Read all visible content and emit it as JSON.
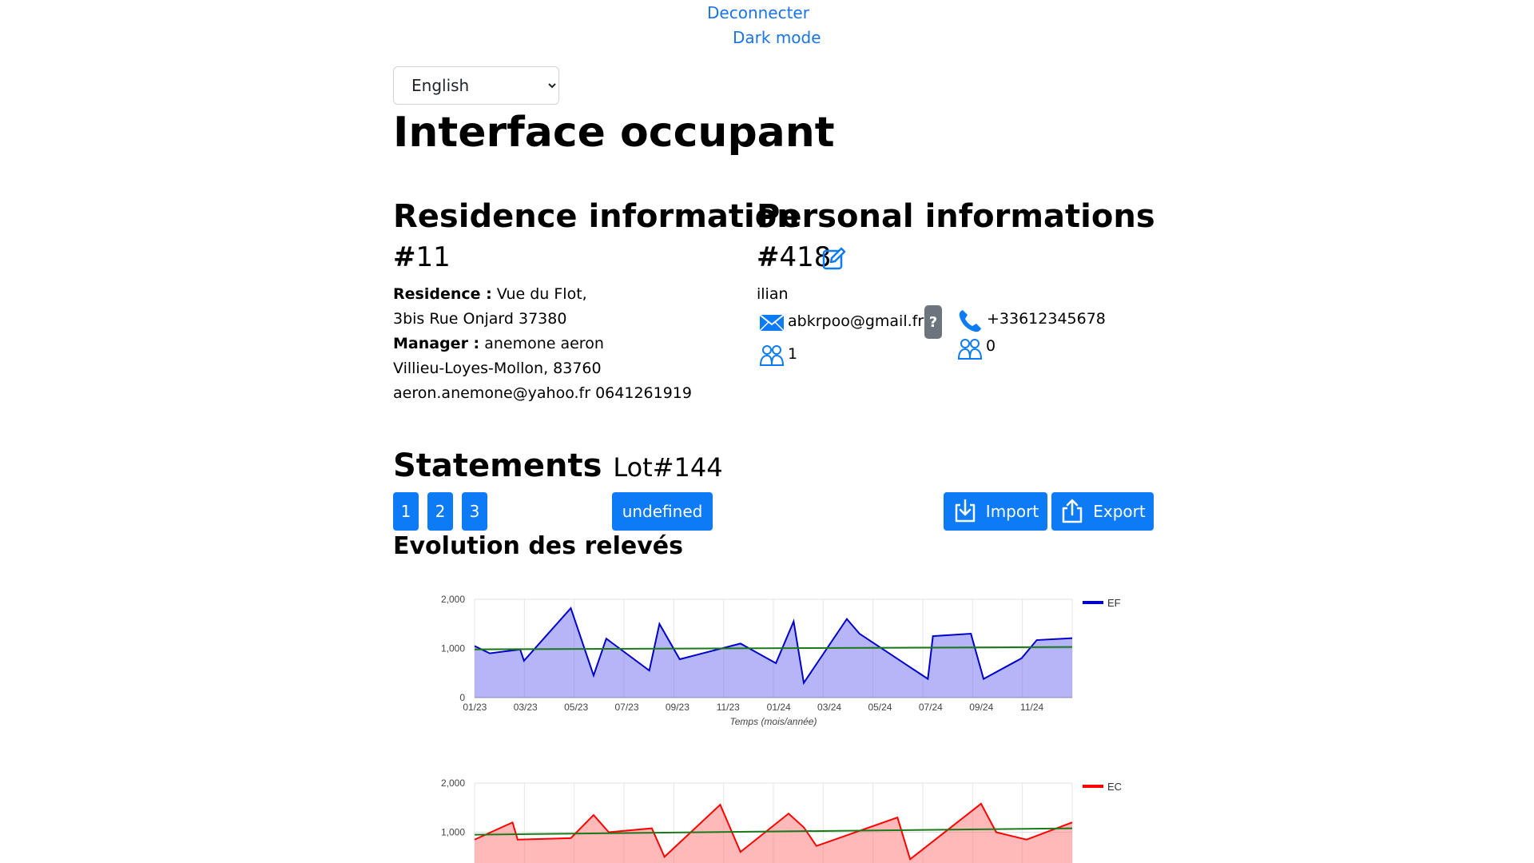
{
  "top_links": {
    "logout": "Deconnecter",
    "dark_mode": "Dark mode"
  },
  "language": {
    "selected": "English"
  },
  "page_title": "Interface occupant",
  "residence": {
    "heading": "Residence information",
    "hash": "#",
    "id": "11",
    "residence_label": "Residence :",
    "residence_name": " Vue du Flot,",
    "address": "3bis Rue Onjard 37380",
    "manager_label": "Manager :",
    "manager_name": " anemone aeron",
    "manager_city": "Villieu-Loyes-Mollon, 83760",
    "manager_contact": "aeron.anemone@yahoo.fr 0641261919"
  },
  "personal": {
    "heading": "Personal informations",
    "hash": "#",
    "id": "418",
    "name": "ilian",
    "email": "abkrpoo@gmail.fr",
    "help": "?",
    "phone": "+33612345678",
    "adults": "1",
    "children": "0"
  },
  "statements": {
    "heading": "Statements",
    "lot": "Lot#144",
    "page_buttons": [
      "1",
      "2",
      "3"
    ],
    "undefined_button": "undefined",
    "import_label": "Import",
    "export_label": "Export",
    "evolution_title": "Evolution des relevés"
  },
  "colors": {
    "accent": "#0d7bf5",
    "ef": "#0000cc",
    "ec": "#ff0000",
    "trend": "#1a7a1a"
  },
  "chart_data": [
    {
      "type": "area",
      "legend": "EF",
      "xlabel": "Temps (mois/année)",
      "ylim": [
        0,
        2000
      ],
      "yticks": [
        "2,000",
        "1,000",
        "0"
      ],
      "xticks": [
        "01/23",
        "03/23",
        "05/23",
        "07/23",
        "09/23",
        "11/23",
        "01/24",
        "03/24",
        "05/24",
        "07/24",
        "09/24",
        "11/24"
      ],
      "x": [
        0,
        0.6,
        1.8,
        1.95,
        3.8,
        4.7,
        5.2,
        6.9,
        7.3,
        8.1,
        10.5,
        11.9,
        12.6,
        13.0,
        14.7,
        15.2,
        17.9,
        18.1,
        19.6,
        20.1,
        21.6,
        22.2,
        23.6
      ],
      "y": [
        1050,
        900,
        980,
        750,
        1820,
        450,
        1200,
        550,
        1500,
        780,
        1100,
        700,
        1550,
        300,
        1600,
        1300,
        380,
        1250,
        1300,
        380,
        800,
        1170,
        1210
      ],
      "trend": [
        980,
        1030
      ],
      "legend_position": "top-right",
      "grid": true
    },
    {
      "type": "area",
      "legend": "EC",
      "ylim": [
        0,
        2000
      ],
      "yticks": [
        "2,000",
        "1,000"
      ],
      "x": [
        0,
        1.5,
        1.7,
        3.8,
        4.7,
        5.3,
        7.0,
        7.5,
        9.7,
        10.5,
        12.4,
        13.0,
        13.5,
        16.7,
        17.2,
        20.0,
        20.6,
        21.8,
        23.6
      ],
      "y": [
        850,
        1200,
        850,
        880,
        1350,
        1000,
        1080,
        500,
        1560,
        600,
        1380,
        1100,
        720,
        1300,
        450,
        1580,
        1000,
        850,
        1200
      ],
      "trend": [
        950,
        1080
      ],
      "legend_position": "top-right",
      "grid": true
    }
  ]
}
